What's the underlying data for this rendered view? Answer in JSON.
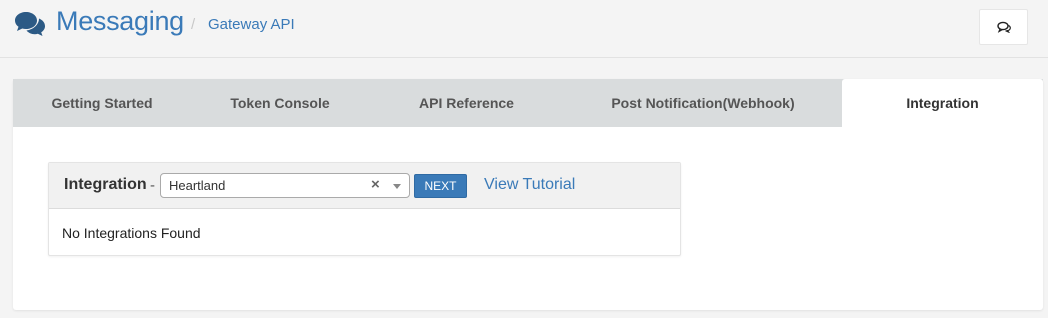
{
  "header": {
    "title": "Messaging",
    "separator": "/",
    "subtitle": "Gateway API",
    "logo_icon": "chat-bubbles-icon",
    "chat_button_icon": "chat-icon"
  },
  "tabs": [
    {
      "label": "Getting Started",
      "active": false
    },
    {
      "label": "Token Console",
      "active": false
    },
    {
      "label": "API Reference",
      "active": false
    },
    {
      "label": "Post Notification(Webhook)",
      "active": false
    },
    {
      "label": "Integration",
      "active": true
    }
  ],
  "integration": {
    "label": "Integration",
    "dash": "-",
    "select_value": "Heartland",
    "clear_symbol": "×",
    "next_label": "NEXT",
    "tutorial_link": "View Tutorial",
    "empty_message": "No Integrations Found"
  },
  "colors": {
    "accent": "#3a7ab8",
    "tab_bar": "#d9dcdd",
    "background": "#f4f4f4"
  }
}
